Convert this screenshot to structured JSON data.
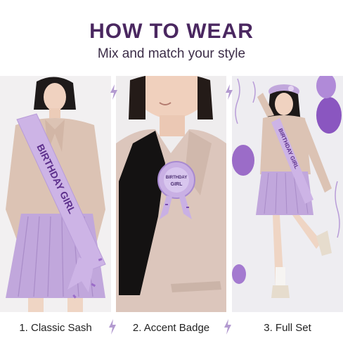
{
  "header": {
    "title": "HOW TO WEAR",
    "subtitle": "Mix and match your style"
  },
  "panels": [
    {
      "caption": "1. Classic Sash",
      "sash_text": "BIRTHDAY GIRL"
    },
    {
      "caption": "2. Accent Badge",
      "badge_line1": "BIRTHDAY",
      "badge_line2": "GIRL"
    },
    {
      "caption": "3. Full Set",
      "sash_text": "BIRTHDAY GIRL"
    }
  ],
  "colors": {
    "title": "#4a2760",
    "lavender": "#c9b0e4",
    "sash_text": "#5c2f8c",
    "bolt": "#b39ad0"
  },
  "icons": {
    "separator": "lightning-bolt-icon"
  }
}
